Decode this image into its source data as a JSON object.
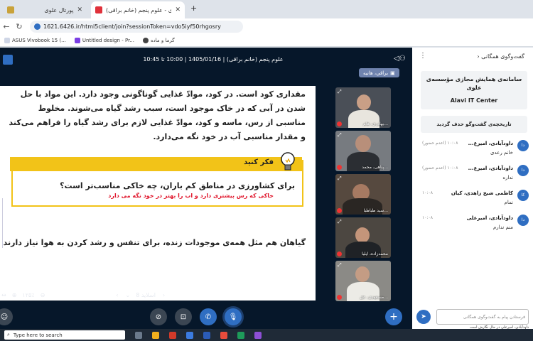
{
  "browser": {
    "tabs": [
      {
        "label": "پورتال علوی",
        "close": "✕"
      },
      {
        "label": "علوی - علوم پنجم (خانم براقی)",
        "close": "✕"
      }
    ],
    "new_tab": "+",
    "url": "1621.6426.ir/html5client/join?sessionToken=vdo5iyf50rhgosry",
    "bookmarks": [
      {
        "label": "ASUS Vivobook 15 (..."
      },
      {
        "label": "Untitled design - Pr..."
      },
      {
        "label": "گرما و ماده"
      }
    ]
  },
  "meeting": {
    "title": "علوم پنجم (خانم براقی) | 1405/01/16 | 10:00 تا 10:45",
    "presenter": "براقي، هانيه"
  },
  "slide": {
    "paragraph": "مقداری کود است. در کود، موادّ غذایی گوناگونی وجود دارد. این مواد با حل شدن در آبی که در خاک موجود است، سبب رشد گیاه می‌شوند. مخلوط مناسبی از رس، ماسه و کود، موادّ غذایی لازم برای رشد گیاه را فراهم می‌کند و مقدار مناسبی آب در خود نگه می‌دارد.",
    "think_label": "فکر کنید",
    "question": "برای کشاورزی در مناطق کم باران، چه خاکی مناسب‌تر است؟",
    "answer": "خاکی که رس بیشتری دارد و اب را بهتر در خود نگه می دارد",
    "last_line": "گیاهان هم مثل همه‌ی موجودات زنده، برای تنفس و رشد کردن به هوا نیاز دارند."
  },
  "slide_toolbar": {
    "slide_label": "اسلاید 8",
    "zoom": "۱۲۵٪"
  },
  "videos": [
    {
      "name": "بهادری، هام..."
    },
    {
      "name": "پناهی، محمد..."
    },
    {
      "name": "سید طباطبا..."
    },
    {
      "name": "محمدزاده، ایلیا"
    },
    {
      "name": "مسعودی، عل..."
    }
  ],
  "chat": {
    "title": "گفت‌وگوی همگانی",
    "close": "✕",
    "pinned_title": "سامانه‌ی همایش مجازی مؤسسه‌ی علوی",
    "pinned_subtitle": "Alavi IT Center",
    "cleared": "تاریخچه‌ی گفت‌وگو حذف گردید",
    "messages": [
      {
        "initials": "دا",
        "name": "داودآبادی، امیرع...",
        "time": "۱۰:۰۸ (اعدم حضور)",
        "text": "خانم رعدی"
      },
      {
        "initials": "دا",
        "name": "داودآبادی، امیرع...",
        "time": "۱۰:۰۸ (اعدم حضور)",
        "text": "نداره"
      },
      {
        "initials": "کا",
        "name": "کاظمی شیخ زاهدی، کیان",
        "time": "۱۰:۰۸",
        "text": "نمام"
      },
      {
        "initials": "دا",
        "name": "داودآبادی، امیرعلی",
        "time": "۱۰:۰۸",
        "text": "منم ندارم"
      }
    ],
    "input_placeholder": "فرستادن پیام به گفت‌وگوی همگانی",
    "send": "➤",
    "typing": "داودآبادی، امیرعلی در حال نگارش است"
  },
  "taskbar": {
    "search_placeholder": "Type here to search"
  }
}
